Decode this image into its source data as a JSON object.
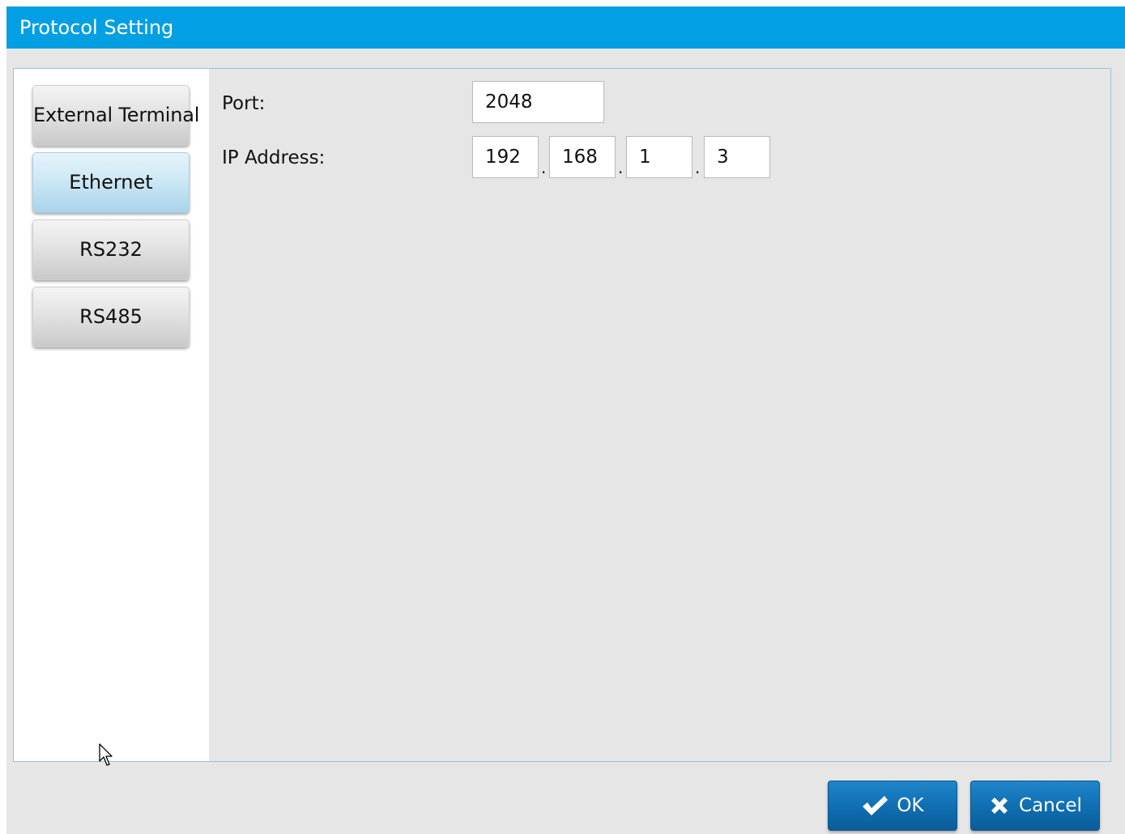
{
  "window": {
    "title": "Protocol Setting"
  },
  "sidebar": {
    "items": [
      {
        "label": "External Terminal",
        "active": false
      },
      {
        "label": "Ethernet",
        "active": true
      },
      {
        "label": "RS232",
        "active": false
      },
      {
        "label": "RS485",
        "active": false
      }
    ]
  },
  "form": {
    "port_label": "Port:",
    "port_value": "2048",
    "ip_label": "IP Address:",
    "ip_octets": [
      "192",
      "168",
      "1",
      "3"
    ],
    "ip_separator": "."
  },
  "footer": {
    "ok_label": "OK",
    "cancel_label": "Cancel"
  },
  "colors": {
    "titlebar": "#02a0e3",
    "active_tab": "#cde8f5",
    "action_button": "#0f6db0"
  },
  "icons": {
    "ok": "checkmark-icon",
    "cancel": "x-icon",
    "pointer": "mouse-pointer-icon"
  }
}
